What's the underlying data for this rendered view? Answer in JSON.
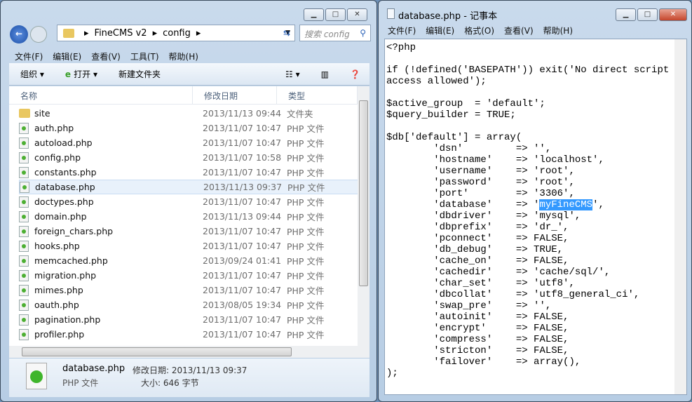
{
  "explorer": {
    "breadcrumb": [
      "FineCMS v2",
      "config"
    ],
    "search_placeholder": "搜索 config",
    "menu": [
      "文件(F)",
      "编辑(E)",
      "查看(V)",
      "工具(T)",
      "帮助(H)"
    ],
    "toolbar": {
      "organize": "组织 ▾",
      "open": "打开 ▾",
      "new_folder": "新建文件夹"
    },
    "columns": [
      "名称",
      "修改日期",
      "类型"
    ],
    "files": [
      {
        "name": "site",
        "date": "2013/11/13 09:44",
        "type": "文件夹",
        "folder": true
      },
      {
        "name": "auth.php",
        "date": "2013/11/07 10:47",
        "type": "PHP 文件"
      },
      {
        "name": "autoload.php",
        "date": "2013/11/07 10:47",
        "type": "PHP 文件"
      },
      {
        "name": "config.php",
        "date": "2013/11/07 10:58",
        "type": "PHP 文件"
      },
      {
        "name": "constants.php",
        "date": "2013/11/07 10:47",
        "type": "PHP 文件"
      },
      {
        "name": "database.php",
        "date": "2013/11/13 09:37",
        "type": "PHP 文件",
        "selected": true
      },
      {
        "name": "doctypes.php",
        "date": "2013/11/07 10:47",
        "type": "PHP 文件"
      },
      {
        "name": "domain.php",
        "date": "2013/11/13 09:44",
        "type": "PHP 文件"
      },
      {
        "name": "foreign_chars.php",
        "date": "2013/11/07 10:47",
        "type": "PHP 文件"
      },
      {
        "name": "hooks.php",
        "date": "2013/11/07 10:47",
        "type": "PHP 文件"
      },
      {
        "name": "memcached.php",
        "date": "2013/09/24 01:41",
        "type": "PHP 文件"
      },
      {
        "name": "migration.php",
        "date": "2013/11/07 10:47",
        "type": "PHP 文件"
      },
      {
        "name": "mimes.php",
        "date": "2013/11/07 10:47",
        "type": "PHP 文件"
      },
      {
        "name": "oauth.php",
        "date": "2013/08/05 19:34",
        "type": "PHP 文件"
      },
      {
        "name": "pagination.php",
        "date": "2013/11/07 10:47",
        "type": "PHP 文件"
      },
      {
        "name": "profiler.php",
        "date": "2013/11/07 10:47",
        "type": "PHP 文件"
      }
    ],
    "details": {
      "name": "database.php",
      "modified": "修改日期: 2013/11/13 09:37",
      "type": "PHP 文件",
      "size": "大小: 646 字节"
    }
  },
  "notepad": {
    "title": "database.php - 记事本",
    "menu": [
      "文件(F)",
      "编辑(E)",
      "格式(O)",
      "查看(V)",
      "帮助(H)"
    ],
    "code_before": "<?php\n\nif (!defined('BASEPATH')) exit('No direct script\naccess allowed');\n\n$active_group  = 'default';\n$query_builder = TRUE;\n\n$db['default'] = array(\n\t'dsn'\t      => '',\n\t'hostname'    => 'localhost',\n\t'username'    => 'root',\n\t'password'    => 'root',\n\t'port'\t      => '3306',\n\t'database'    => '",
    "code_selected": "myFineCMS",
    "code_after": "',\n\t'dbdriver'    => 'mysql',\n\t'dbprefix'    => 'dr_',\n\t'pconnect'    => FALSE,\n\t'db_debug'    => TRUE,\n\t'cache_on'    => FALSE,\n\t'cachedir'    => 'cache/sql/',\n\t'char_set'    => 'utf8',\n\t'dbcollat'    => 'utf8_general_ci',\n\t'swap_pre'    => '',\n\t'autoinit'    => FALSE,\n\t'encrypt'     => FALSE,\n\t'compress'    => FALSE,\n\t'stricton'    => FALSE,\n\t'failover'    => array(),\n);"
  }
}
